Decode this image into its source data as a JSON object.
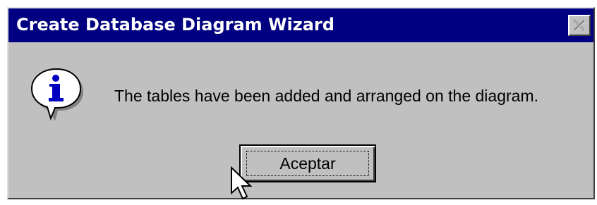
{
  "window": {
    "title": "Create Database Diagram Wizard",
    "close_icon": "close-x-icon"
  },
  "message": {
    "icon": "information-icon",
    "text": "The tables have been added and arranged on the diagram."
  },
  "buttons": {
    "ok_label": "Aceptar"
  },
  "cursor": {
    "icon": "mouse-pointer-icon"
  },
  "colors": {
    "titlebar": "#000080",
    "dialog_face": "#c0c0c0",
    "title_text": "#ffffff"
  }
}
